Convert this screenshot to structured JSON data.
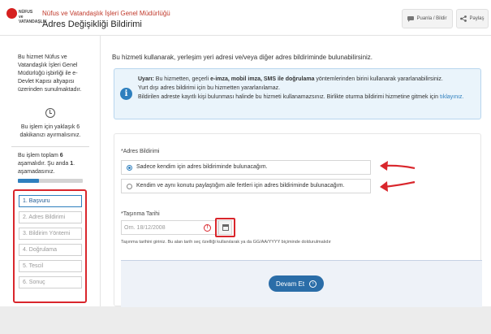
{
  "header": {
    "org_name": "Nüfus ve Vatandaşlık İşleri Genel Müdürlüğü",
    "page_title": "Adres Değişikliği Bildirimi",
    "rate_button": "Puanla / Bildir",
    "share_button": "Paylaş",
    "logo_text": "NÜFUS ve VATANDAŞLIK"
  },
  "sidebar": {
    "description": "Bu hizmet Nüfus ve Vatandaşlık İşleri Genel Müdürlüğü işbirliği ile e-Devlet Kapısı altyapısı üzerinden sunulmaktadır.",
    "time_text": "Bu işlem için yaklaşık 6 dakikanızı ayırmalısınız.",
    "steps_text_before_total": "Bu işlem toplam ",
    "steps_total": "6",
    "steps_text_mid": " aşamalıdır. Şu anda ",
    "steps_current": "1",
    "steps_text_after": ". aşamadasınız.",
    "progress_fraction": 0.33,
    "steps": [
      {
        "label": "1. Başvuru",
        "active": true
      },
      {
        "label": "2. Adres Bildirimi",
        "active": false
      },
      {
        "label": "3. Bildirim Yöntemi",
        "active": false
      },
      {
        "label": "4. Doğrulama",
        "active": false
      },
      {
        "label": "5. Tescil",
        "active": false
      },
      {
        "label": "6. Sonuç",
        "active": false
      }
    ]
  },
  "main": {
    "intro": "Bu hizmeti kullanarak, yerleşim yeri adresi ve/veya diğer adres bildiriminde bulunabilirsiniz.",
    "info": {
      "warning_label": "Uyarı:",
      "line1_a": " Bu hizmetten, geçerli ",
      "line1_bold": "e-imza, mobil imza, SMS ile doğrulama",
      "line1_b": " yöntemlerinden birini kullanarak yararlanabilirsiniz.",
      "line2": "Yurt dışı adres bildirimi için bu hizmetten yararlanılamaz.",
      "line3": "Bildirilen adreste kayıtlı kişi bulunması halinde bu hizmeti kullanamazsınız. Birlikte oturma bildirimi hizmetine gitmek için",
      "link": "tıklayınız."
    },
    "form": {
      "address_label": "*Adres Bildirimi",
      "options": [
        {
          "label": "Sadece kendim için adres bildiriminde bulunacağım.",
          "selected": true
        },
        {
          "label": "Kendim ve aynı konutu paylaştığım aile fertleri için adres bildiriminde bulunacağım.",
          "selected": false
        }
      ],
      "date_label": "*Taşınma Tarihi",
      "date_placeholder": "Örn. 18/12/2008",
      "error_mark": "!",
      "date_hint": "Taşınma tarihini giriniz. Bu alan tarih seç özelliği kullanılarak ya da GG/AA/YYYY biçiminde doldurulmalıdır",
      "submit_label": "Devam Et"
    }
  },
  "colors": {
    "accent": "#2e7fbe",
    "annotation_red": "#d9262c",
    "submit": "#2a6da8"
  }
}
